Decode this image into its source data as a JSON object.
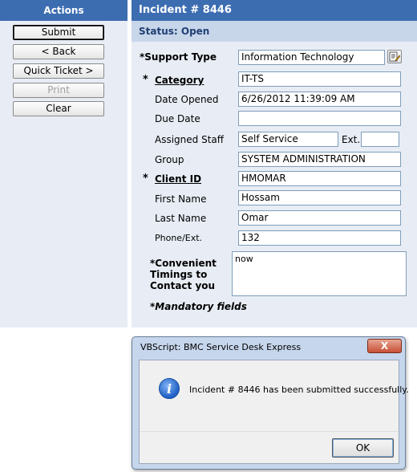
{
  "actions": {
    "header": "Actions",
    "submit": "Submit",
    "back": "< Back",
    "quick_ticket": "Quick Ticket >",
    "print": "Print",
    "clear": "Clear"
  },
  "incident": {
    "header": "Incident # 8446",
    "status": "Status: Open"
  },
  "form": {
    "support_type_label": "*Support Type",
    "support_type_value": "Information Technology",
    "category_label": "Category",
    "category_value": "IT-TS",
    "date_opened_label": "Date Opened",
    "date_opened_value": "6/26/2012 11:39:09 AM",
    "due_date_label": "Due Date",
    "due_date_value": "",
    "assigned_staff_label": "Assigned Staff",
    "assigned_staff_value": "Self Service",
    "ext_label": "Ext.",
    "ext_value": "",
    "group_label": "Group",
    "group_value": "SYSTEM ADMINISTRATION",
    "client_id_label": "Client ID",
    "client_id_value": "HMOMAR",
    "first_name_label": "First Name",
    "first_name_value": "Hossam",
    "last_name_label": "Last Name",
    "last_name_value": "Omar",
    "phone_label": "Phone/Ext.",
    "phone_value": "132",
    "timings_label_1": "*Convenient",
    "timings_label_2": "Timings to",
    "timings_label_3": "Contact you",
    "timings_value": "now",
    "mandatory_note": "*Mandatory fields",
    "req_marker": "*"
  },
  "dialog": {
    "title": "VBScript: BMC Service Desk Express",
    "close": "X",
    "message": "Incident # 8446 has been submitted successfully.",
    "ok": "OK",
    "info_glyph": "i"
  }
}
